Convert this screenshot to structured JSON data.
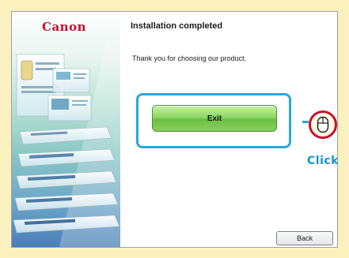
{
  "brand": {
    "logo_text": "Canon",
    "logo_color": "#c8102e"
  },
  "header": {
    "title": "Installation completed"
  },
  "main": {
    "message": "Thank you for choosing our product."
  },
  "buttons": {
    "exit_label": "Exit",
    "back_label": "Back"
  },
  "callout": {
    "click_label": "Click",
    "icon": "mouse-icon",
    "accent": "#2aa7dc",
    "circle_color": "#c8102e"
  },
  "colors": {
    "page_background": "#fbf1bf",
    "exit_green": "#8fd866"
  }
}
